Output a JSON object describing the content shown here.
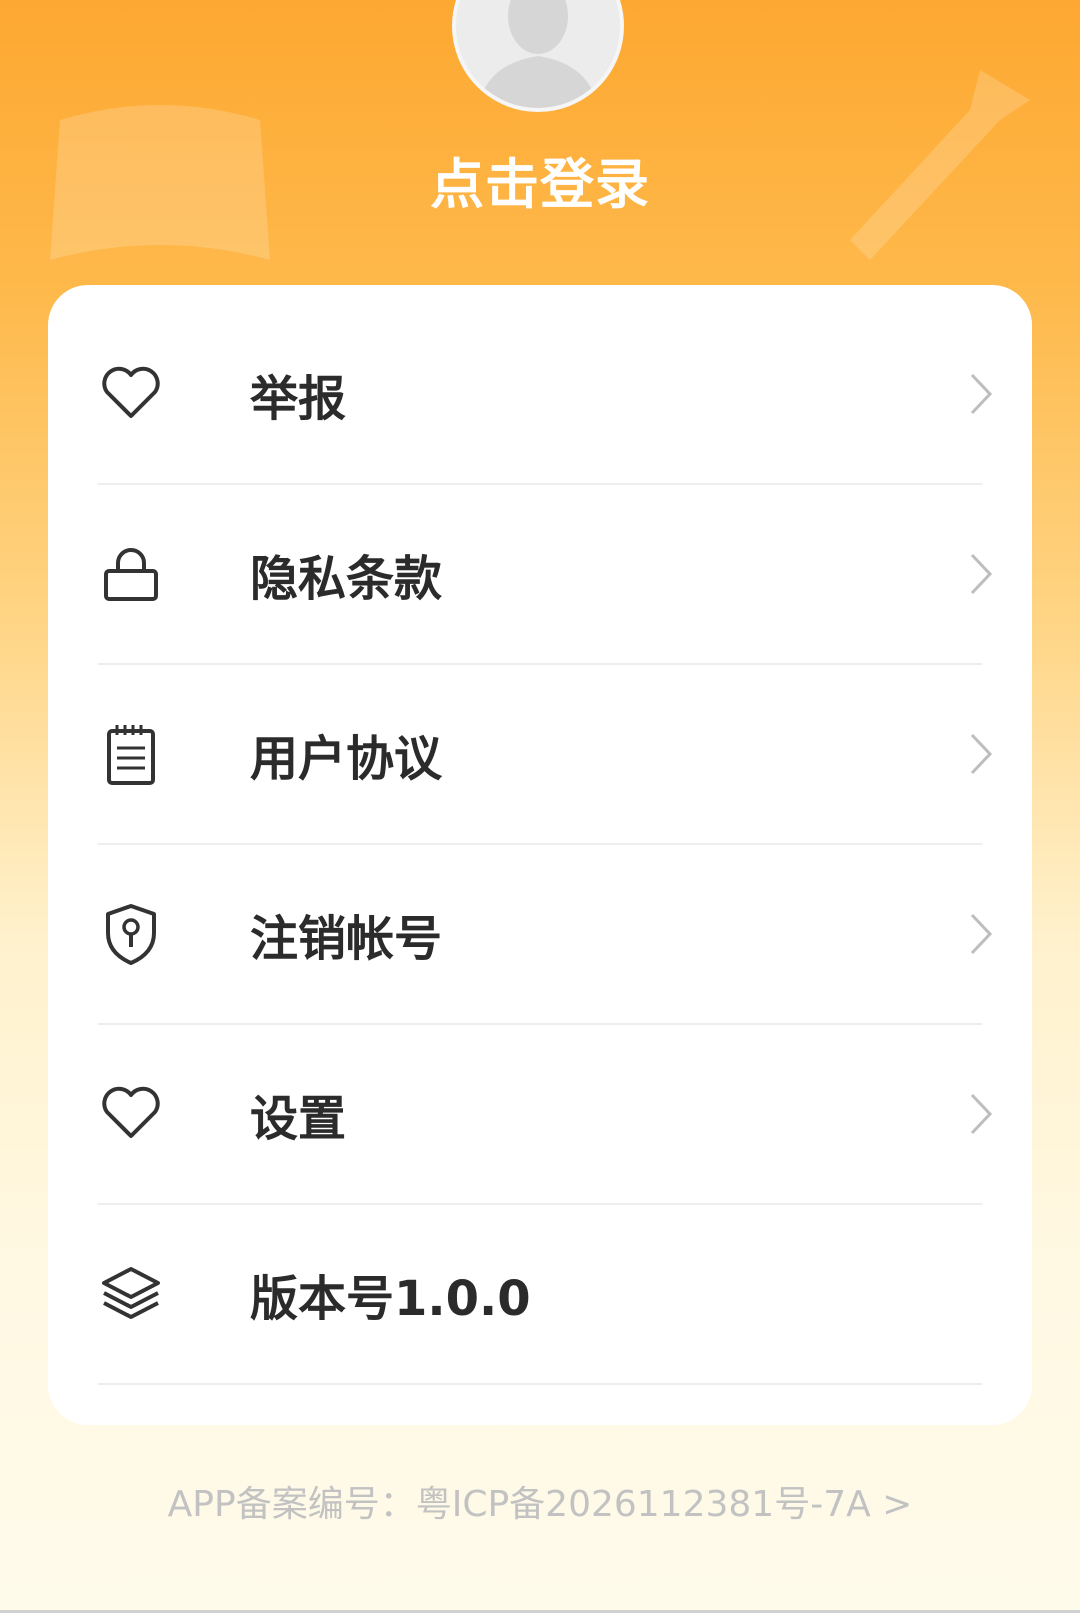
{
  "header": {
    "login_label": "点击登录",
    "avatar_icon": "default-user-avatar"
  },
  "menu": {
    "items": [
      {
        "label": "举报",
        "icon": "heart-icon",
        "has_chevron": true
      },
      {
        "label": "隐私条款",
        "icon": "lock-icon",
        "has_chevron": true
      },
      {
        "label": "用户协议",
        "icon": "notepad-icon",
        "has_chevron": true
      },
      {
        "label": "注销帐号",
        "icon": "shield-keyhole-icon",
        "has_chevron": true
      },
      {
        "label": "设置",
        "icon": "heart-icon",
        "has_chevron": true
      },
      {
        "label": "版本号1.0.0",
        "icon": "layers-icon",
        "has_chevron": false
      }
    ]
  },
  "footer": {
    "icp_text": "APP备案编号：粤ICP备2026112381号-7A >"
  },
  "colors": {
    "header_orange": "#FDA831",
    "label_text": "#2b2b2b",
    "icon_stroke": "#333333",
    "chevron": "#bdbdbd",
    "footer_text": "#c2c2c2"
  }
}
